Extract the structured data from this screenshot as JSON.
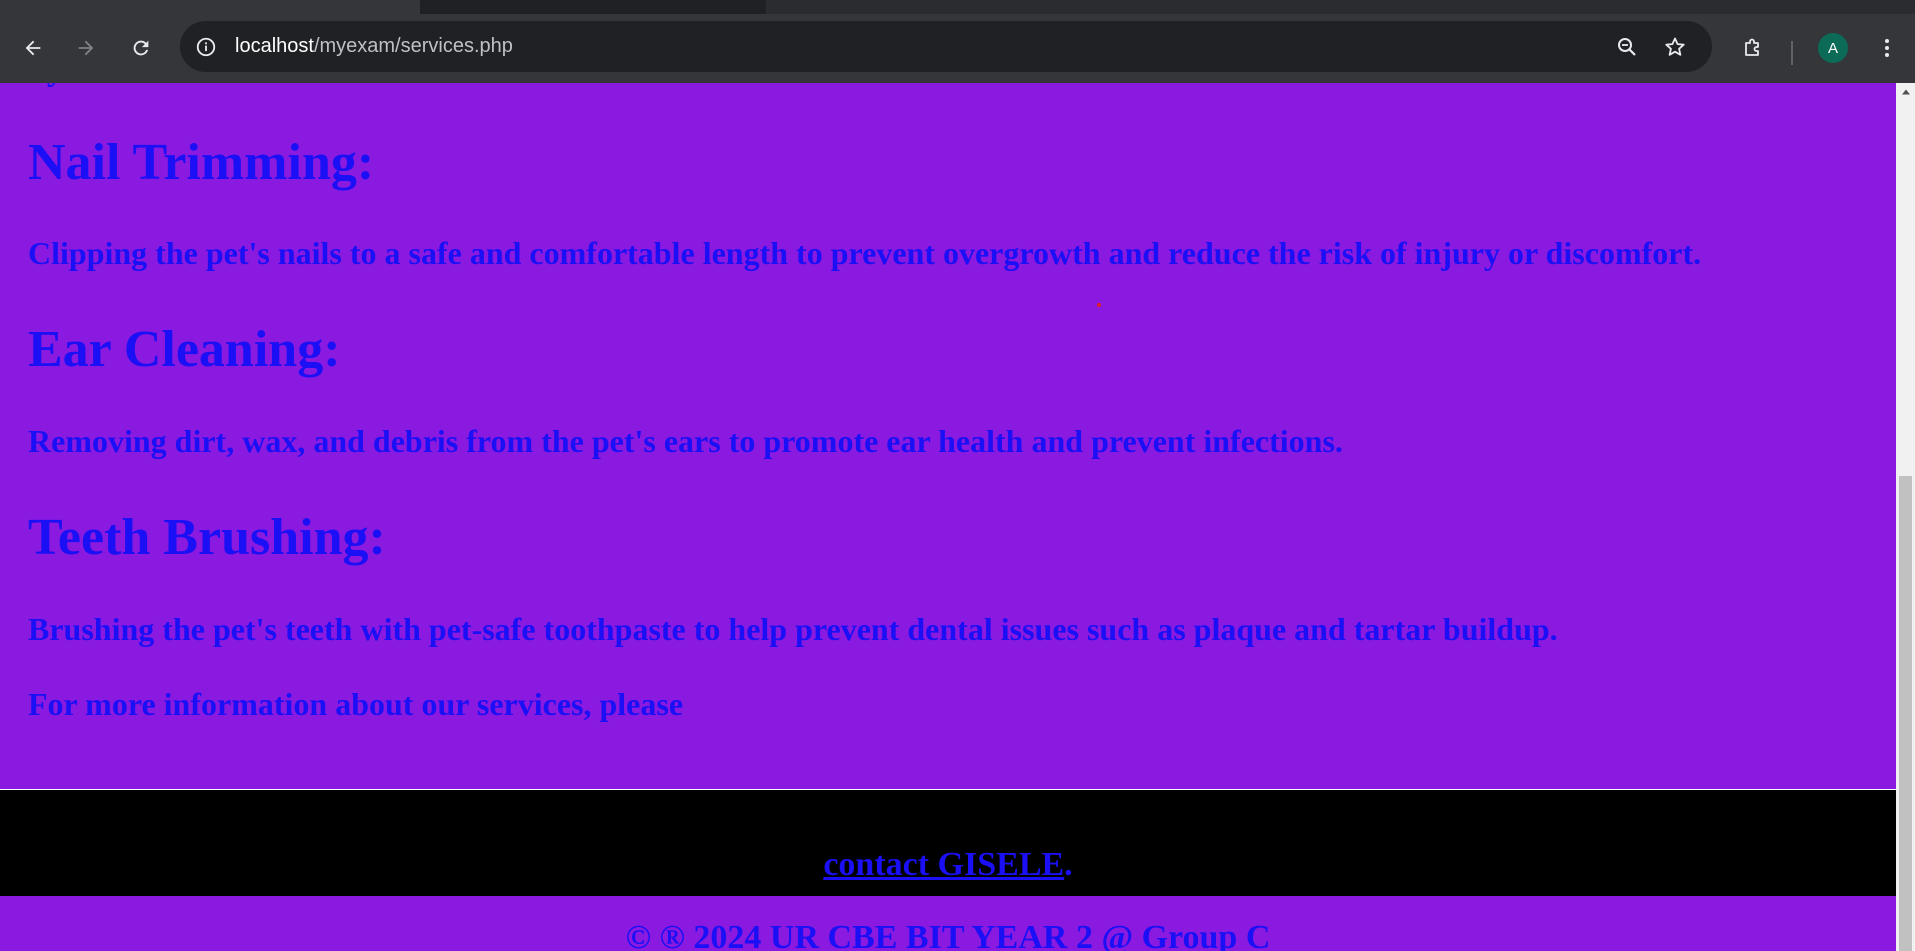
{
  "browser": {
    "url_host": "localhost",
    "url_path": "/myexam/services.php",
    "avatar_letter": "A",
    "icons": {
      "back": "arrow-left-icon",
      "forward": "arrow-right-icon",
      "reload": "reload-icon",
      "site_info": "info-icon",
      "zoom": "zoom-icon",
      "bookmark": "star-icon",
      "extensions": "puzzle-icon",
      "menu": "kebab-menu-icon"
    }
  },
  "page": {
    "background_color": "#8a1adf",
    "text_color": "#1a0ff5",
    "top_cut_text": "by",
    "services": [
      {
        "title": "Nail Trimming:",
        "description": "Clipping the pet's nails to a safe and comfortable length to prevent overgrowth and reduce the risk of injury or discomfort."
      },
      {
        "title": "Ear Cleaning:",
        "description": "Removing dirt, wax, and debris from the pet's ears to promote ear health and prevent infections."
      },
      {
        "title": "Teeth Brushing:",
        "description": "Brushing the pet's teeth with pet-safe toothpaste to help prevent dental issues such as plaque and tartar buildup."
      }
    ],
    "more_info_text": "For more information about our services, please",
    "footer": {
      "contact_link": "contact GISELE",
      "contact_suffix": ".",
      "copyright": "© ® 2024 UR CBE BIT YEAR 2 @ Group C"
    }
  }
}
